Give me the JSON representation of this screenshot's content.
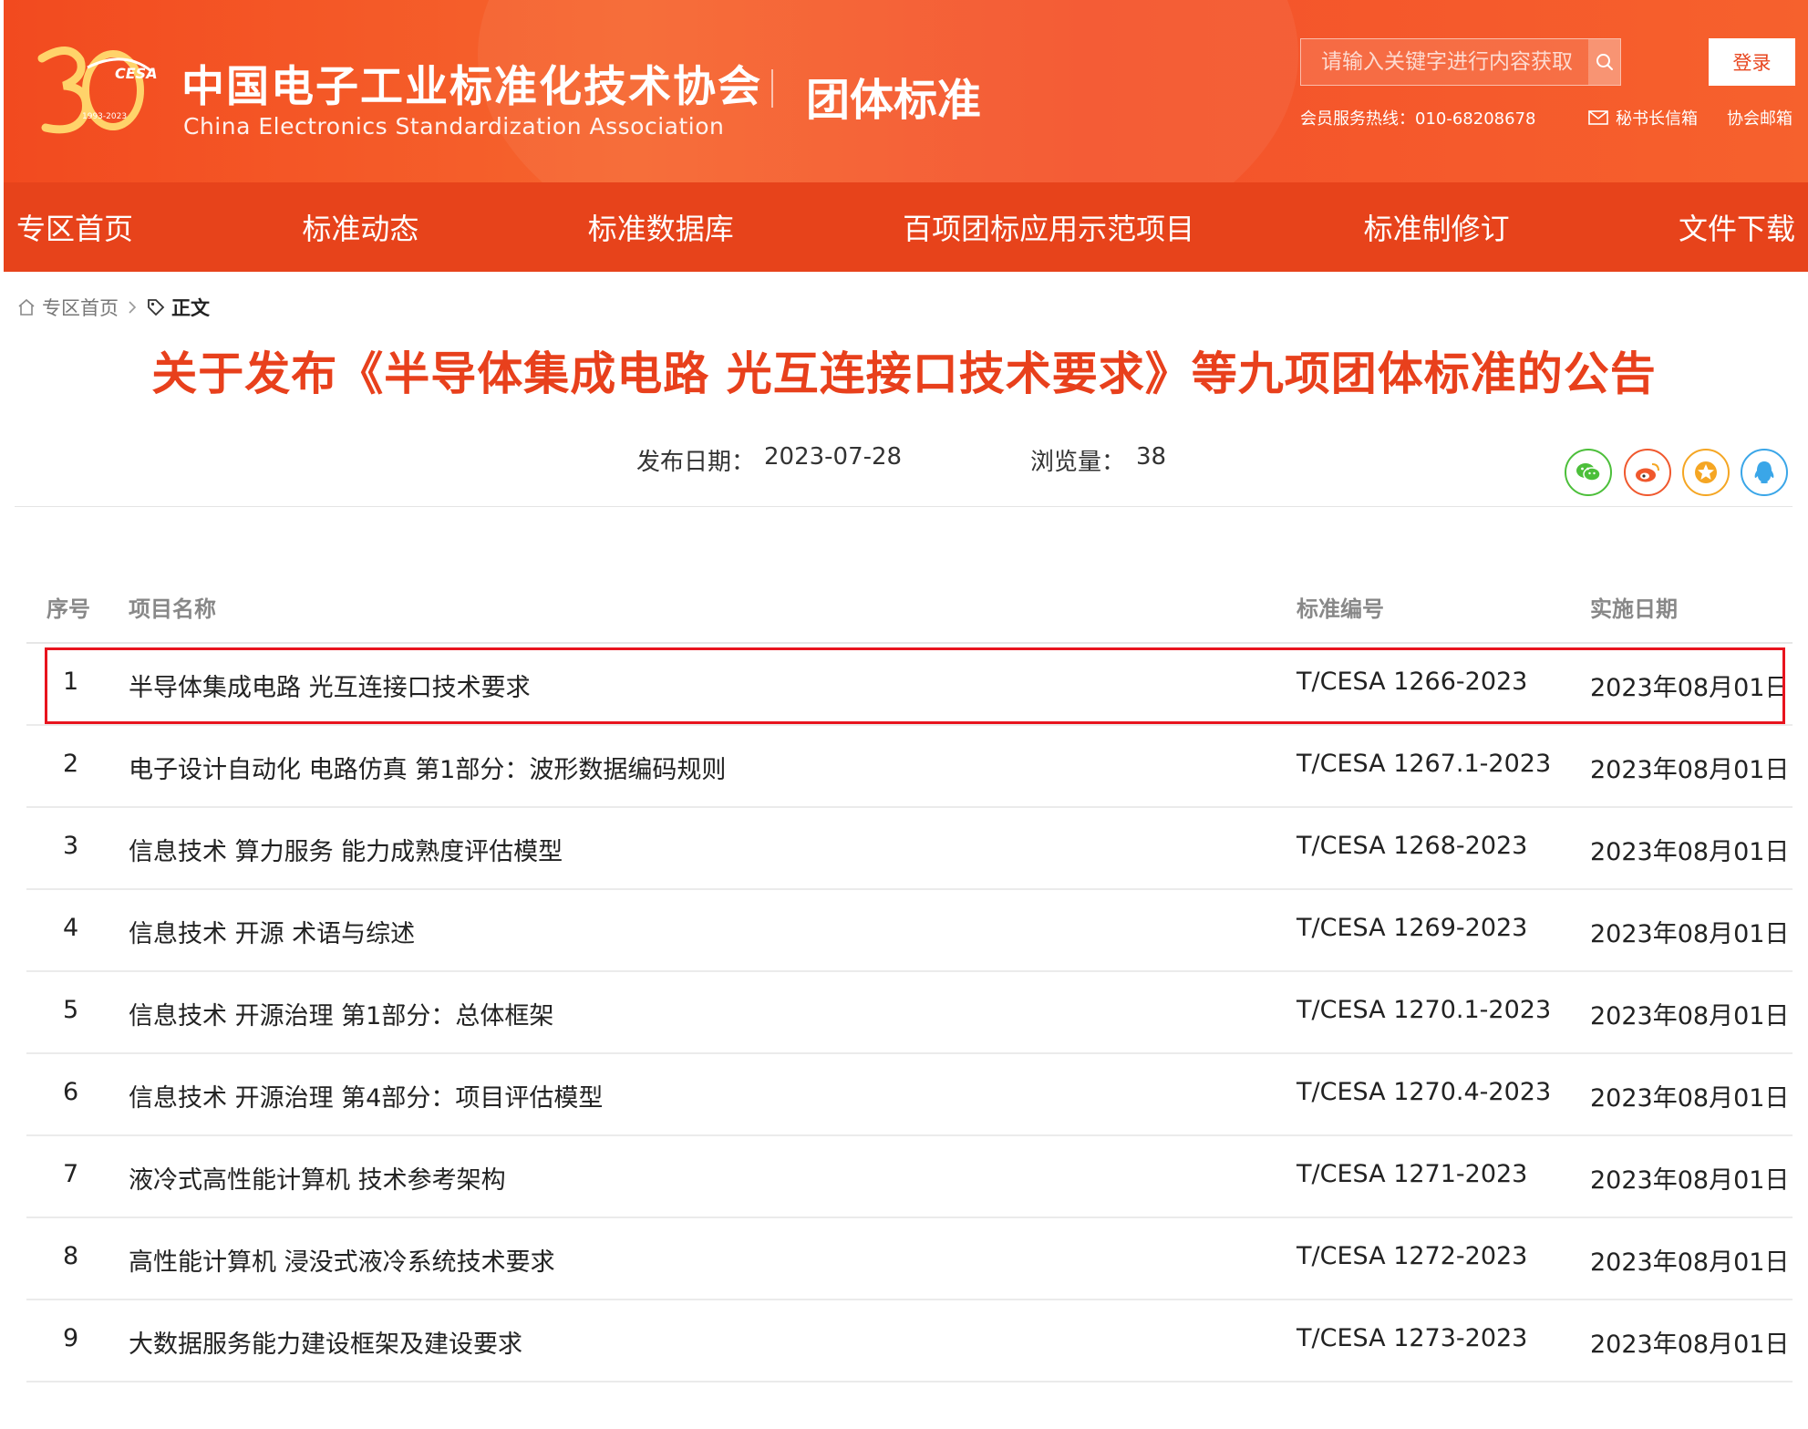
{
  "header": {
    "logo_text": "CESA",
    "logo_years": "1993-2023",
    "site_title": "中国电子工业标准化技术协会",
    "site_subtitle": "China Electronics Standardization Association",
    "section_title": "团体标准",
    "search_placeholder": "请输入关键字进行内容获取",
    "login_label": "登录",
    "hotline": "会员服务热线：010-68208678",
    "secretary_mail": "秘书长信箱",
    "assoc_mail": "协会邮箱"
  },
  "nav": {
    "items": [
      "专区首页",
      "标准动态",
      "标准数据库",
      "百项团标应用示范项目",
      "标准制修订",
      "文件下载"
    ]
  },
  "breadcrumb": {
    "home": "专区首页",
    "current": "正文"
  },
  "article": {
    "title": "关于发布《半导体集成电路 光互连接口技术要求》等九项团体标准的公告",
    "date_label": "发布日期：",
    "date_value": "2023-07-28",
    "views_label": "浏览量：",
    "views_value": "38"
  },
  "share": {
    "wechat": "wechat-icon",
    "weibo": "weibo-icon",
    "favorite": "star-icon",
    "qq": "qq-icon"
  },
  "table": {
    "headers": [
      "序号",
      "项目名称",
      "标准编号",
      "实施日期"
    ],
    "rows": [
      {
        "no": "1",
        "name": "半导体集成电路 光互连接口技术要求",
        "code": "T/CESA 1266-2023",
        "date": "2023年08月01日"
      },
      {
        "no": "2",
        "name": "电子设计自动化 电路仿真 第1部分：波形数据编码规则",
        "code": "T/CESA 1267.1-2023",
        "date": "2023年08月01日"
      },
      {
        "no": "3",
        "name": "信息技术 算力服务 能力成熟度评估模型",
        "code": "T/CESA 1268-2023",
        "date": "2023年08月01日"
      },
      {
        "no": "4",
        "name": "信息技术 开源 术语与综述",
        "code": "T/CESA 1269-2023",
        "date": "2023年08月01日"
      },
      {
        "no": "5",
        "name": "信息技术 开源治理 第1部分：总体框架",
        "code": "T/CESA 1270.1-2023",
        "date": "2023年08月01日"
      },
      {
        "no": "6",
        "name": "信息技术 开源治理 第4部分：项目评估模型",
        "code": "T/CESA 1270.4-2023",
        "date": "2023年08月01日"
      },
      {
        "no": "7",
        "name": "液冷式高性能计算机 技术参考架构",
        "code": "T/CESA 1271-2023",
        "date": "2023年08月01日"
      },
      {
        "no": "8",
        "name": "高性能计算机 浸没式液冷系统技术要求",
        "code": "T/CESA 1272-2023",
        "date": "2023年08月01日"
      },
      {
        "no": "9",
        "name": "大数据服务能力建设框架及建设要求",
        "code": "T/CESA 1273-2023",
        "date": "2023年08月01日"
      }
    ]
  },
  "colors": {
    "brand": "#e7431b",
    "title_red": "#e8401c",
    "highlight": "#e8141e"
  }
}
